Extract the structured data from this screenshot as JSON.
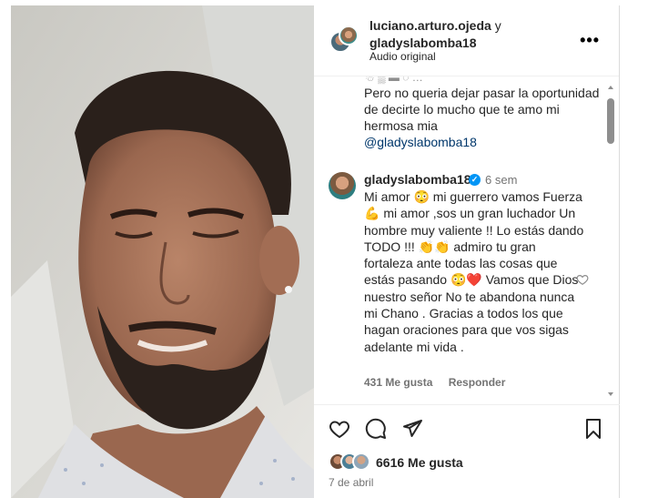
{
  "post": {
    "owners": {
      "user1": "luciano.arturo.ojeda",
      "joiner": "y",
      "user2": "gladyslabomba18"
    },
    "audio": "Audio original",
    "more_icon": "more-horizontal-icon"
  },
  "previous_comment": {
    "emoji_strip": "☃ ▒ ▬ ◌ …",
    "text": "Pero no queria dejar pasar la oportunidad de decirte lo mucho que te amo mi hermosa mia",
    "mention": "@gladyslabomba18"
  },
  "comment": {
    "username": "gladyslabomba18",
    "verified": "✓",
    "time": "6 sem",
    "text": "Mi amor 😳 mi guerrero vamos Fuerza 💪 mi amor ,sos un gran luchador Un hombre muy valiente !! Lo estás dando TODO !!! 👏👏 admiro tu gran fortaleza ante todas las cosas que estás pasando 😳❤️ Vamos que Dios nuestro señor No te abandona nunca mi Chano . Gracias a todos los que hagan oraciones para que vos sigas adelante mi vida .",
    "likes": "431 Me gusta",
    "reply": "Responder"
  },
  "footer": {
    "likes": "6616 Me gusta",
    "date": "7 de abril"
  }
}
